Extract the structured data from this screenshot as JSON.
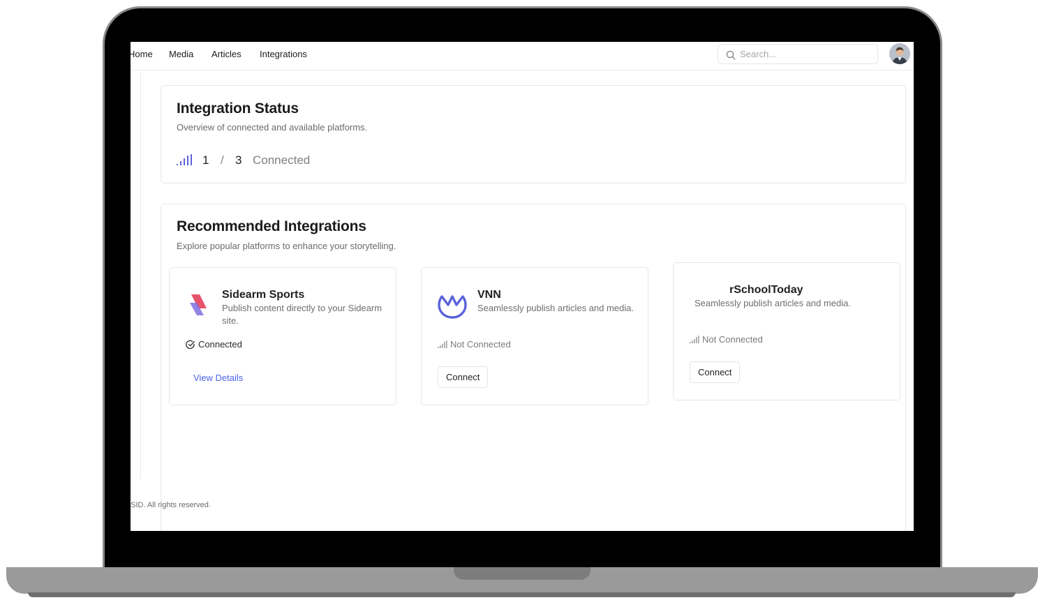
{
  "nav": {
    "links": [
      "Home",
      "Media",
      "Articles",
      "Integrations"
    ],
    "search_placeholder": "Search..."
  },
  "status": {
    "title": "Integration Status",
    "subtitle": "Overview of connected and available platforms.",
    "connected_count": "1",
    "separator": "/",
    "total_count": "3",
    "label": "Connected"
  },
  "recommended": {
    "title": "Recommended Integrations",
    "subtitle": "Explore popular platforms to enhance your storytelling.",
    "items": [
      {
        "name": "Sidearm Sports",
        "description": "Publish content directly to your Sidearm site.",
        "status": "Connected",
        "action": "View Details"
      },
      {
        "name": "VNN",
        "description": "Seamlessly publish articles and media.",
        "status": "Not Connected",
        "action": "Connect"
      },
      {
        "name": "rSchoolToday",
        "description": "Seamlessly publish articles and media.",
        "status": "Not Connected",
        "action": "Connect"
      }
    ]
  },
  "footer": {
    "text": "SID. All rights reserved."
  },
  "colors": {
    "accent": "#4a63e6",
    "vnn_logo": "#5b63d9",
    "sidearm_logo_pink": "#e8536b",
    "sidearm_logo_violet": "#7d6fe0",
    "muted_text": "#6e6e6e"
  },
  "icons": {
    "search": "search-icon",
    "signal": "signal-bars-icon",
    "connected": "check-circle-icon",
    "avatar": "user-avatar"
  }
}
